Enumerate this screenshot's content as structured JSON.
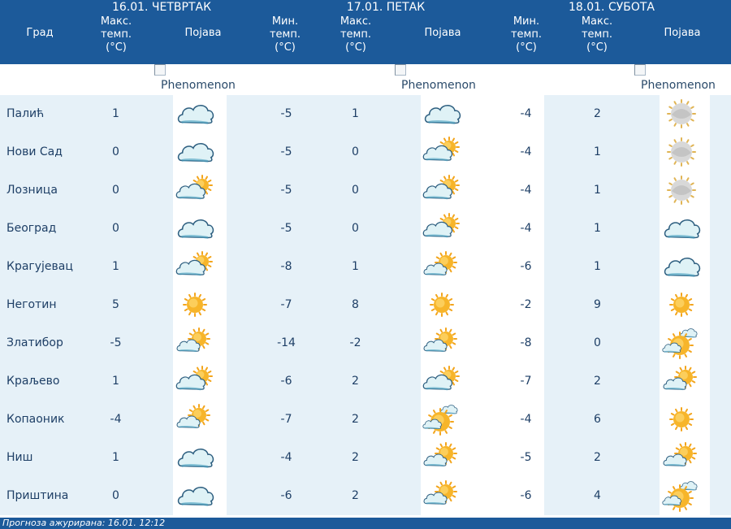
{
  "days": [
    {
      "label": "16.01. ЧЕТВРТАК"
    },
    {
      "label": "17.01. ПЕТАК"
    },
    {
      "label": "18.01. СУБОТА"
    }
  ],
  "columns": {
    "city": "Град",
    "max": "Макс.\nтемп.\n(°C)",
    "min": "Мин.\nтемп.\n(°C)",
    "phenomenon": "Појава"
  },
  "broken_image_alt": "Phenomenon",
  "rows": [
    {
      "city": "Палић",
      "d1": {
        "max": "1",
        "icon": "cloud"
      },
      "d2": {
        "min": "-5",
        "max": "1",
        "icon": "cloud"
      },
      "d3": {
        "min": "-4",
        "max": "2",
        "icon": "sun-grey"
      }
    },
    {
      "city": "Нови Сад",
      "d1": {
        "max": "0",
        "icon": "cloud"
      },
      "d2": {
        "min": "-5",
        "max": "0",
        "icon": "cloud-sun"
      },
      "d3": {
        "min": "-4",
        "max": "1",
        "icon": "sun-grey"
      }
    },
    {
      "city": "Лозница",
      "d1": {
        "max": "0",
        "icon": "cloud-sun"
      },
      "d2": {
        "min": "-5",
        "max": "0",
        "icon": "cloud-sun"
      },
      "d3": {
        "min": "-4",
        "max": "1",
        "icon": "sun-grey"
      }
    },
    {
      "city": "Београд",
      "d1": {
        "max": "0",
        "icon": "cloud"
      },
      "d2": {
        "min": "-5",
        "max": "0",
        "icon": "cloud-sun"
      },
      "d3": {
        "min": "-4",
        "max": "1",
        "icon": "cloud"
      }
    },
    {
      "city": "Крагујевац",
      "d1": {
        "max": "1",
        "icon": "cloud-sun"
      },
      "d2": {
        "min": "-8",
        "max": "1",
        "icon": "sun-cloud-small"
      },
      "d3": {
        "min": "-6",
        "max": "1",
        "icon": "cloud"
      }
    },
    {
      "city": "Неготин",
      "d1": {
        "max": "5",
        "icon": "sun"
      },
      "d2": {
        "min": "-7",
        "max": "8",
        "icon": "sun"
      },
      "d3": {
        "min": "-2",
        "max": "9",
        "icon": "sun"
      }
    },
    {
      "city": "Златибор",
      "d1": {
        "max": "-5",
        "icon": "sun-cloud-small"
      },
      "d2": {
        "min": "-14",
        "max": "-2",
        "icon": "sun-cloud-small"
      },
      "d3": {
        "min": "-8",
        "max": "0",
        "icon": "sun-big-cloud"
      }
    },
    {
      "city": "Краљево",
      "d1": {
        "max": "1",
        "icon": "cloud-sun"
      },
      "d2": {
        "min": "-6",
        "max": "2",
        "icon": "cloud-sun"
      },
      "d3": {
        "min": "-7",
        "max": "2",
        "icon": "sun-cloud-small"
      }
    },
    {
      "city": "Копаоник",
      "d1": {
        "max": "-4",
        "icon": "sun-cloud-small"
      },
      "d2": {
        "min": "-7",
        "max": "2",
        "icon": "sun-big-cloud"
      },
      "d3": {
        "min": "-4",
        "max": "6",
        "icon": "sun"
      }
    },
    {
      "city": "Ниш",
      "d1": {
        "max": "1",
        "icon": "cloud"
      },
      "d2": {
        "min": "-4",
        "max": "2",
        "icon": "sun-cloud-small"
      },
      "d3": {
        "min": "-5",
        "max": "2",
        "icon": "sun-cloud-small"
      }
    },
    {
      "city": "Приштина",
      "d1": {
        "max": "0",
        "icon": "cloud"
      },
      "d2": {
        "min": "-6",
        "max": "2",
        "icon": "sun-cloud-small"
      },
      "d3": {
        "min": "-6",
        "max": "4",
        "icon": "sun-big-cloud"
      }
    }
  ],
  "footer": {
    "text": "Прогноза ажурирана:  16.01.  12:12"
  },
  "colors": {
    "header_bg": "#1c5a9a",
    "row_light": "#e6f1f8",
    "row_white": "#ffffff",
    "text": "#1e3f66"
  }
}
